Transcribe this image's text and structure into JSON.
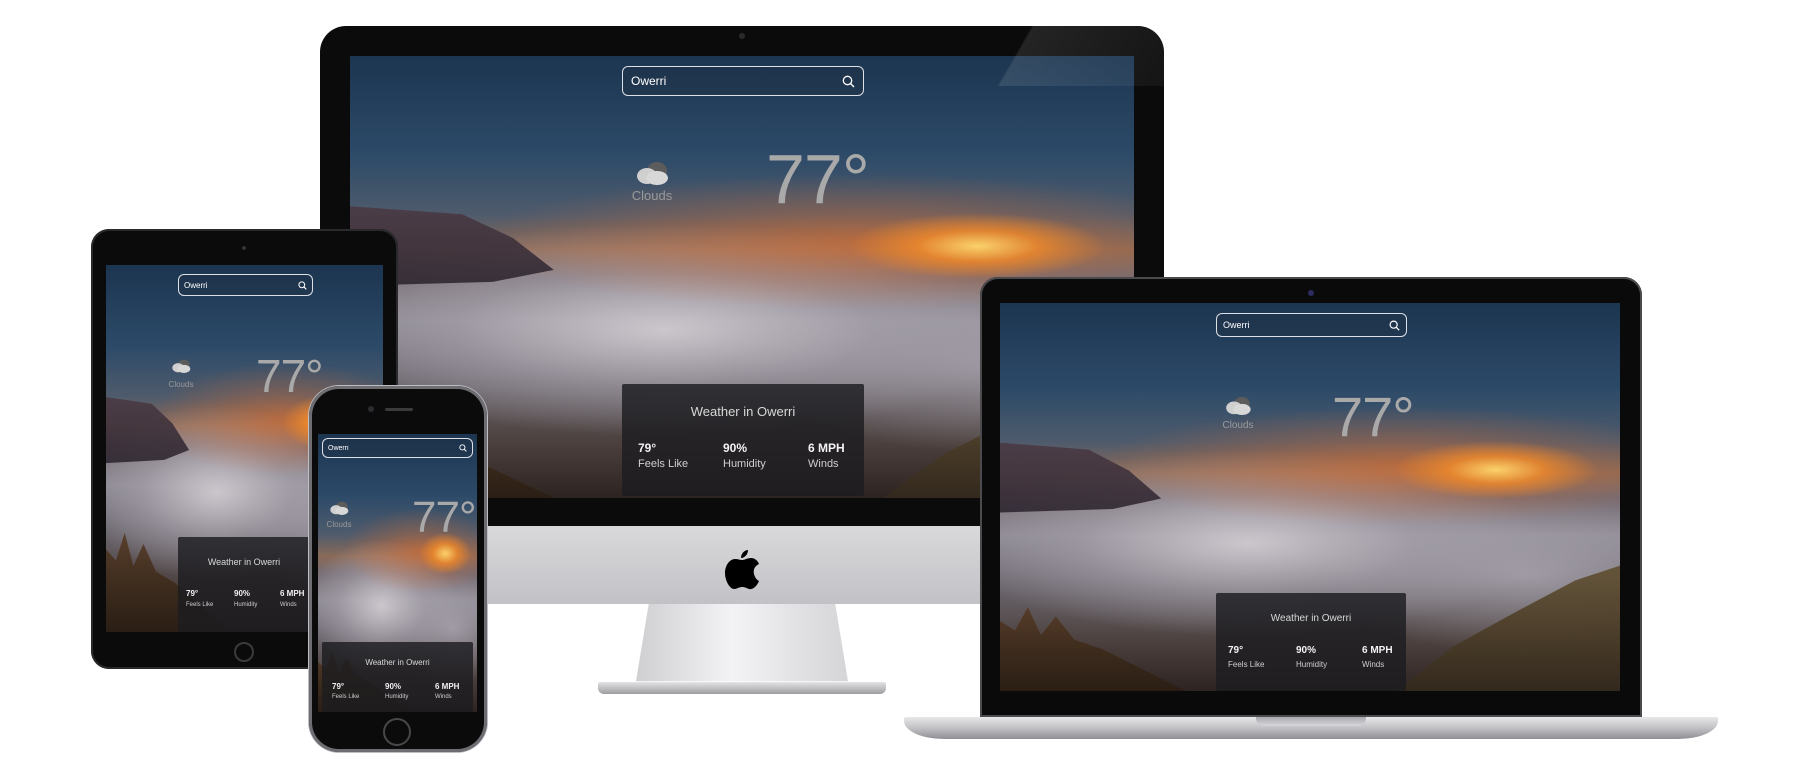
{
  "app": {
    "search_value": "Owerri",
    "condition": "Clouds",
    "temperature": "77°",
    "card_title": "Weather in Owerri",
    "stats": [
      {
        "value": "79°",
        "label": "Feels Like"
      },
      {
        "value": "90%",
        "label": "Humidity"
      },
      {
        "value": "6 MPH",
        "label": "Winds"
      }
    ]
  },
  "icons": {
    "search": "search-icon",
    "weather": "cloud-icon",
    "brand": "apple-logo-icon"
  },
  "colors": {
    "card_bg": "#1c1c20",
    "temp_text": "#a9a9a9",
    "search_border": "#ffffff"
  }
}
